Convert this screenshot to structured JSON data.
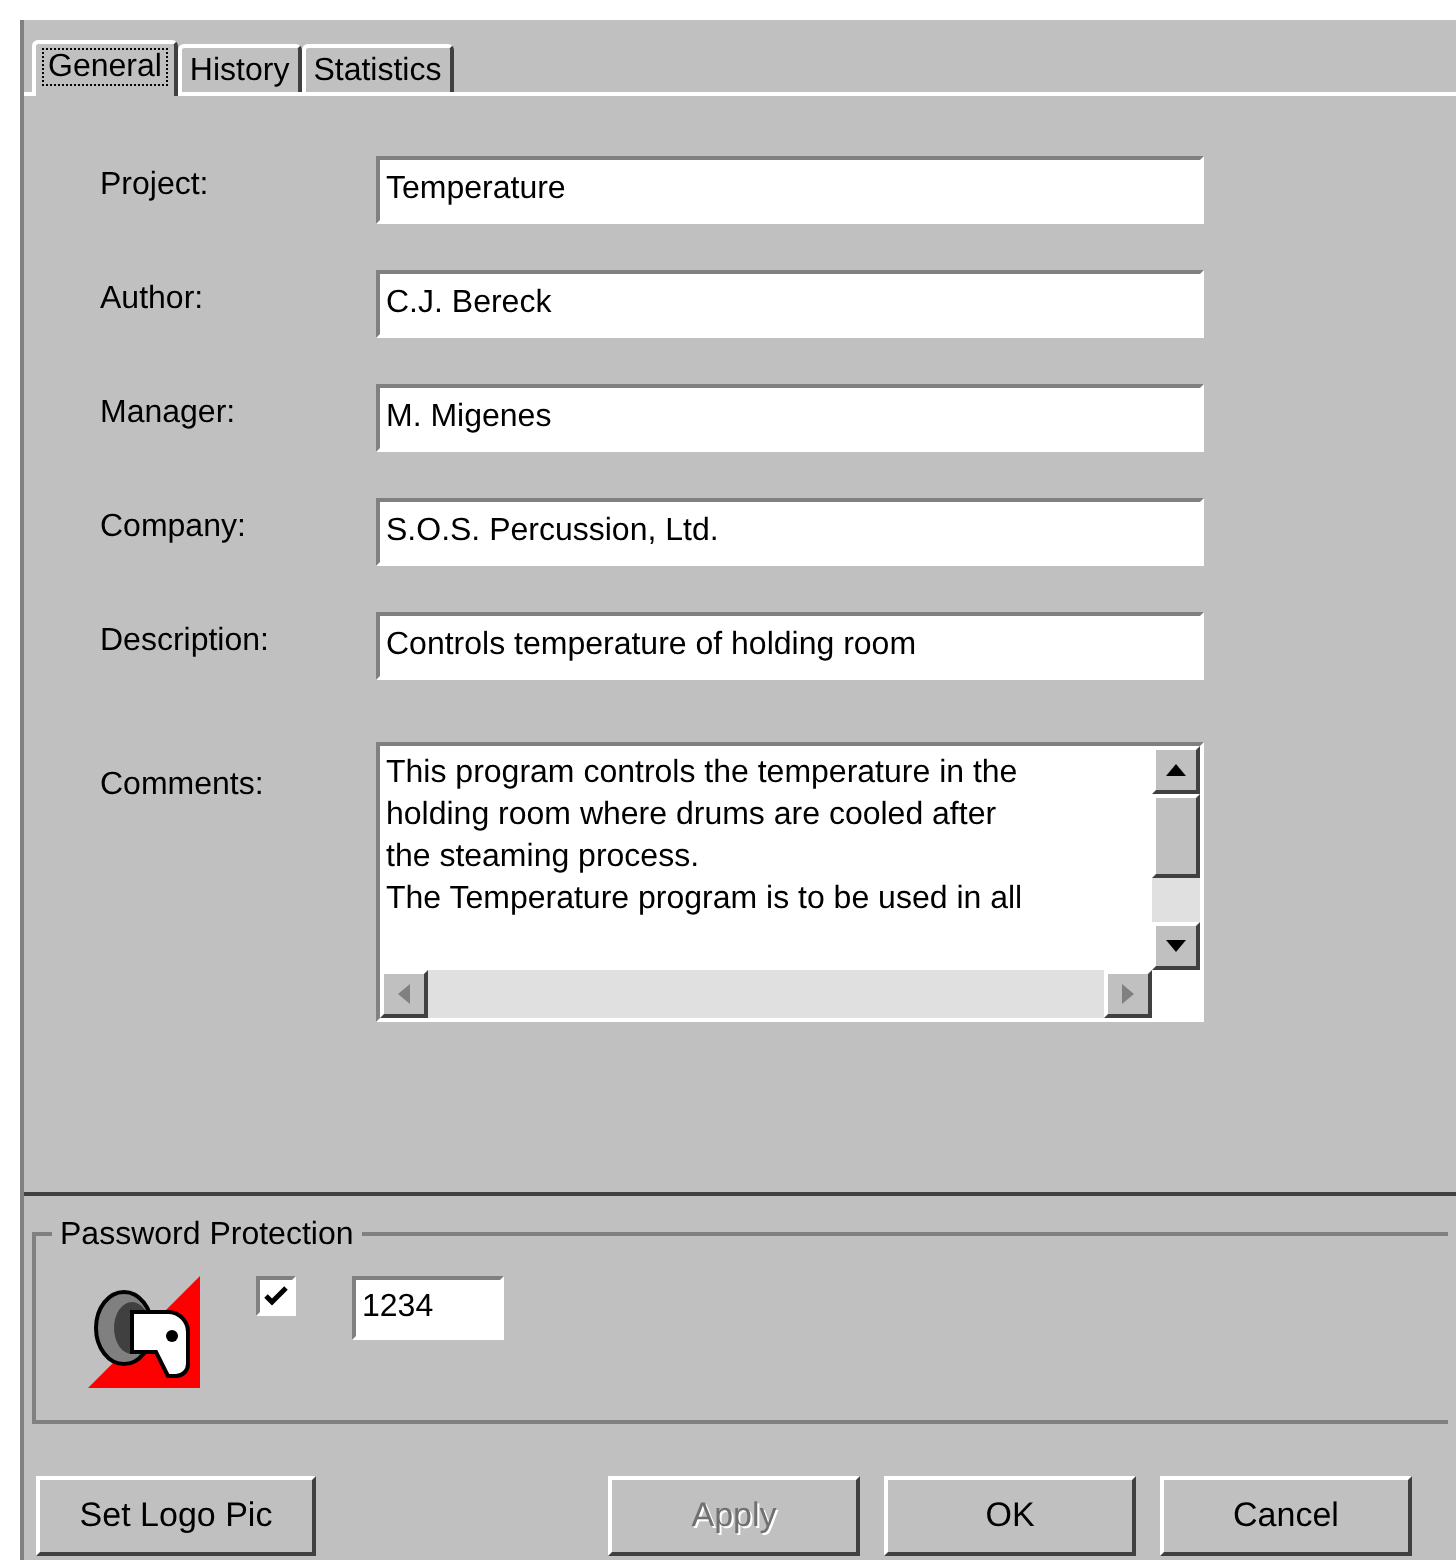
{
  "tabs": [
    {
      "label": "General",
      "selected": true
    },
    {
      "label": "History",
      "selected": false
    },
    {
      "label": "Statistics",
      "selected": false
    }
  ],
  "fields": [
    {
      "label": "Project:",
      "value": "Temperature"
    },
    {
      "label": "Author:",
      "value": "C.J. Bereck"
    },
    {
      "label": "Manager:",
      "value": "M. Migenes"
    },
    {
      "label": "Company:",
      "value": "S.O.S. Percussion, Ltd."
    },
    {
      "label": "Description:",
      "value": "Controls temperature of holding room"
    }
  ],
  "comments": {
    "label": "Comments:",
    "lines": [
      "This program controls the temperature in the",
      "holding room where drums are cooled after",
      "the steaming process.",
      "The Temperature program is to be used in all"
    ]
  },
  "password_protection": {
    "title": "Password Protection",
    "checked": true,
    "value": "1234"
  },
  "buttons": [
    {
      "label": "Set Logo Pic",
      "disabled": false
    },
    {
      "label": "Apply",
      "disabled": true
    },
    {
      "label": "OK",
      "disabled": false
    },
    {
      "label": "Cancel",
      "disabled": false
    }
  ]
}
